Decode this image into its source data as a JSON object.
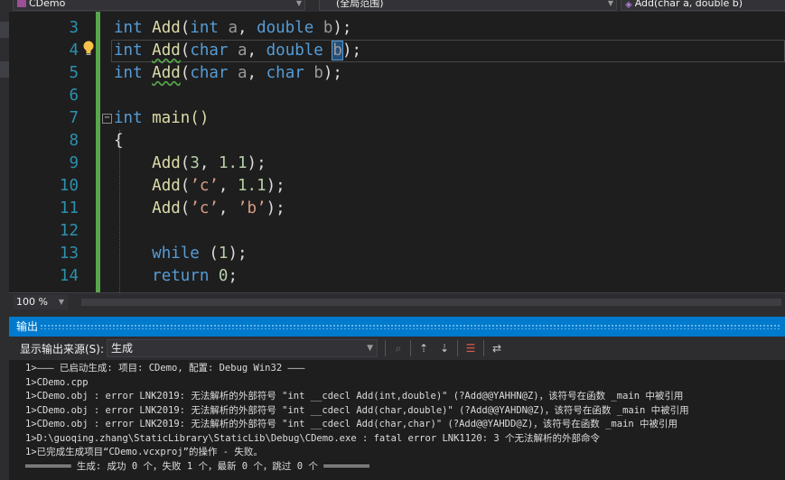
{
  "navbar": {
    "project": "CDemo",
    "scope": "(全局范围)",
    "member": "Add(char a, double b)"
  },
  "editor": {
    "line_numbers": [
      "3",
      "4",
      "5",
      "6",
      "7",
      "8",
      "9",
      "10",
      "11",
      "12",
      "13",
      "14"
    ],
    "code": {
      "l3": {
        "t1": "int",
        "t2": "Add",
        "t3": "(",
        "t4": "int",
        "t5": " a",
        "t6": ", ",
        "t7": "double",
        "t8": " b",
        "t9": ");"
      },
      "l4": {
        "t1": "int",
        "t2": "Add",
        "t3": "(",
        "t4": "char",
        "t5": " a",
        "t6": ", ",
        "t7": "double",
        "t8": " ",
        "t9": "b",
        "t10": ");"
      },
      "l5": {
        "t1": "int",
        "t2": "Add",
        "t3": "(",
        "t4": "char",
        "t5": " a",
        "t6": ", ",
        "t7": "char",
        "t8": " b",
        "t9": ");"
      },
      "l7": {
        "t1": "int",
        "t2": " main()"
      },
      "l8": {
        "t1": "{"
      },
      "l9": {
        "t1": "    ",
        "t2": "Add",
        "t3": "(",
        "t4": "3",
        "t5": ", ",
        "t6": "1.1",
        "t7": ");"
      },
      "l10": {
        "t1": "    ",
        "t2": "Add",
        "t3": "(",
        "t4": "’c’",
        "t5": ", ",
        "t6": "1.1",
        "t7": ");"
      },
      "l11": {
        "t1": "    ",
        "t2": "Add",
        "t3": "(",
        "t4": "’c’",
        "t5": ", ",
        "t6": "’b’",
        "t7": ");"
      },
      "l13": {
        "t1": "    ",
        "t2": "while",
        "t3": " (",
        "t4": "1",
        "t5": ");"
      },
      "l14": {
        "t1": "    ",
        "t2": "return",
        "t3": " ",
        "t4": "0",
        "t5": ";"
      }
    }
  },
  "zoom": {
    "value": "100 %"
  },
  "output": {
    "title": "输出",
    "source_label": "显示输出来源(S):",
    "source_value": "生成",
    "lines": [
      "1>——— 已启动生成: 项目: CDemo, 配置: Debug Win32 ———",
      "1>CDemo.cpp",
      "1>CDemo.obj : error LNK2019: 无法解析的外部符号 \"int __cdecl Add(int,double)\" (?Add@@YAHHN@Z)，该符号在函数 _main 中被引用",
      "1>CDemo.obj : error LNK2019: 无法解析的外部符号 \"int __cdecl Add(char,double)\" (?Add@@YAHDN@Z)，该符号在函数 _main 中被引用",
      "1>CDemo.obj : error LNK2019: 无法解析的外部符号 \"int __cdecl Add(char,char)\" (?Add@@YAHDD@Z)，该符号在函数 _main 中被引用",
      "1>D:\\guoqing.zhang\\StaticLibrary\\StaticLib\\Debug\\CDemo.exe : fatal error LNK1120: 3 个无法解析的外部命令",
      "1>已完成生成项目“CDemo.vcxproj”的操作 - 失败。",
      "════════ 生成: 成功 0 个，失败 1 个，最新 0 个，跳过 0 个 ════════"
    ]
  },
  "colors": {
    "keyword": "#569cd6",
    "function": "#dcdcaa",
    "parameter": "#9a9a9a",
    "number": "#b5cea8",
    "char_literal": "#d69d85",
    "line_number": "#2b91af",
    "accent": "#007acc"
  },
  "icons": [
    "cpp-file-icon",
    "function-icon",
    "lightbulb-icon",
    "collapse-icon",
    "find-message-icon",
    "previous-message-icon",
    "next-message-icon",
    "clear-all-icon",
    "word-wrap-icon"
  ]
}
